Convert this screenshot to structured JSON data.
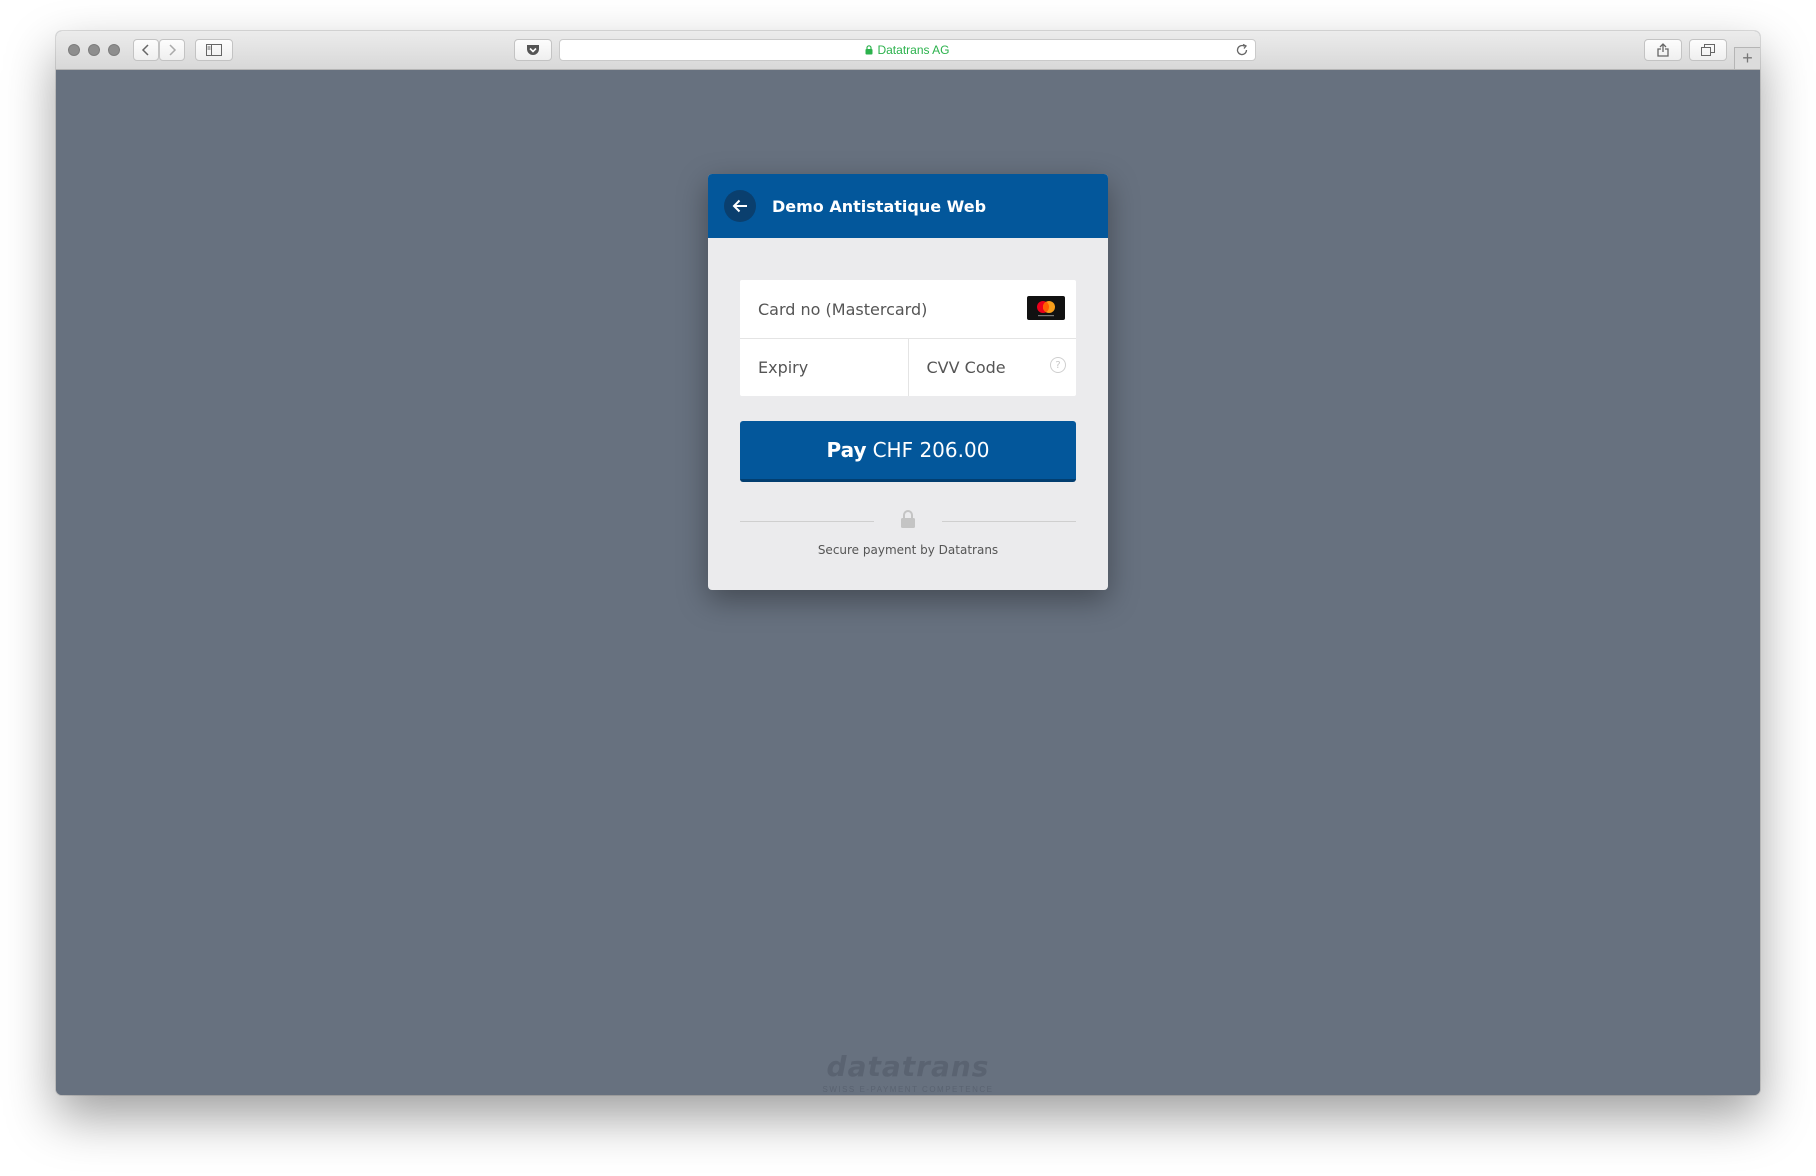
{
  "browser": {
    "address_domain": "Datatrans AG",
    "new_tab_symbol": "+"
  },
  "payment": {
    "merchant_name": "Demo Antistatique Web",
    "card_no_placeholder": "Card no (Mastercard)",
    "card_brand": "Mastercard",
    "expiry_placeholder": "Expiry",
    "cvv_placeholder": "CVV Code",
    "help_symbol": "?",
    "pay_word": "Pay",
    "pay_amount": "CHF 206.00",
    "secure_text": "Secure payment by Datatrans"
  },
  "footer": {
    "logo_text": "datatrans",
    "tagline": "SWISS E-PAYMENT COMPETENCE"
  },
  "colors": {
    "brand_blue": "#03579b",
    "page_background": "#67717f",
    "secure_green": "#2bb24c"
  }
}
